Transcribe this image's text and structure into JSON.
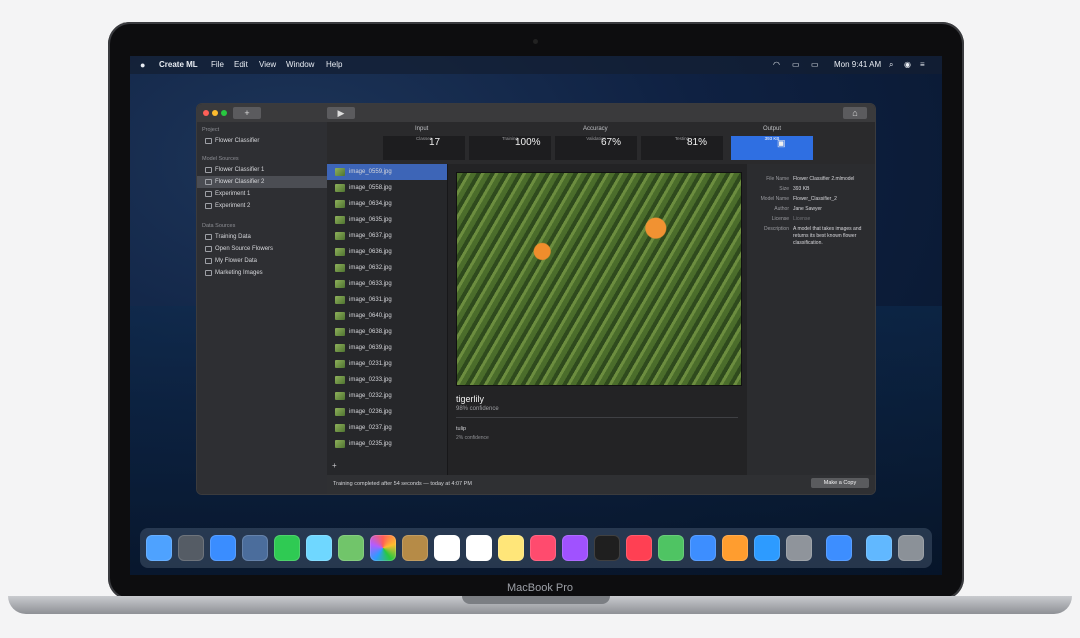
{
  "menubar": {
    "apple": "",
    "app": "Create ML",
    "items": [
      "File",
      "Edit",
      "View",
      "Window",
      "Help"
    ],
    "clock": "Mon 9:41 AM"
  },
  "window": {
    "sidebar": {
      "project_label": "Project",
      "project_name": "Flower Classifier",
      "model_sources_label": "Model Sources",
      "model_sources": [
        "Flower Classifier 1",
        "Flower Classifier 2",
        "Experiment 1",
        "Experiment 2"
      ],
      "data_sources_label": "Data Sources",
      "data_sources": [
        "Training Data",
        "Open Source Flowers",
        "My Flower Data",
        "Marketing Images"
      ]
    },
    "stats": {
      "input_label": "Input",
      "accuracy_label": "Accuracy",
      "output_label": "Output",
      "classes": {
        "value": "17",
        "label": "Classes"
      },
      "training": {
        "value": "100%",
        "label": "Training"
      },
      "validation": {
        "value": "67%",
        "label": "Validation"
      },
      "testing": {
        "value": "81%",
        "label": "Testing"
      },
      "output_size": "393 KB"
    },
    "files": [
      "image_0559.jpg",
      "image_0558.jpg",
      "image_0634.jpg",
      "image_0635.jpg",
      "image_0637.jpg",
      "image_0636.jpg",
      "image_0632.jpg",
      "image_0633.jpg",
      "image_0631.jpg",
      "image_0640.jpg",
      "image_0638.jpg",
      "image_0639.jpg",
      "image_0231.jpg",
      "image_0233.jpg",
      "image_0232.jpg",
      "image_0236.jpg",
      "image_0237.jpg",
      "image_0235.jpg"
    ],
    "prediction": {
      "label": "tigerlily",
      "confidence": "98% confidence",
      "second_label": "tulip",
      "second_confidence": "2% confidence"
    },
    "details": {
      "file_name_label": "File Name",
      "file_name": "Flower Classifier 2.mlmodel",
      "size_label": "Size",
      "size": "393 KB",
      "model_name_label": "Model Name",
      "model_name": "Flower_Classifier_2",
      "author_label": "Author",
      "author": "Jane Sawyer",
      "license_label": "License",
      "license": "License",
      "description_label": "Description",
      "description": "A model that takes images and returns its best known flower classification."
    },
    "status": "Training completed after 54 seconds — today at 4:07 PM",
    "make_copy": "Make a Copy"
  },
  "device_label": "MacBook Pro",
  "dock_icons": [
    "finder-icon",
    "launchpad-icon",
    "safari-icon",
    "photos-icon",
    "facetime-icon",
    "messages-icon",
    "maps-icon",
    "photos-color-icon",
    "notes-icon",
    "calendar-icon",
    "reminders-icon",
    "stickies-icon",
    "music-icon",
    "podcasts-icon",
    "tv-icon",
    "news-icon",
    "numbers-icon",
    "keynote-icon",
    "pages-icon",
    "app-store-icon",
    "system-preferences-icon",
    "create-ml-icon",
    "folder-icon",
    "trash-icon"
  ],
  "colors": {
    "accent": "#3d65b7",
    "window_bg": "#232325",
    "sidebar_bg": "#2e2f33"
  }
}
